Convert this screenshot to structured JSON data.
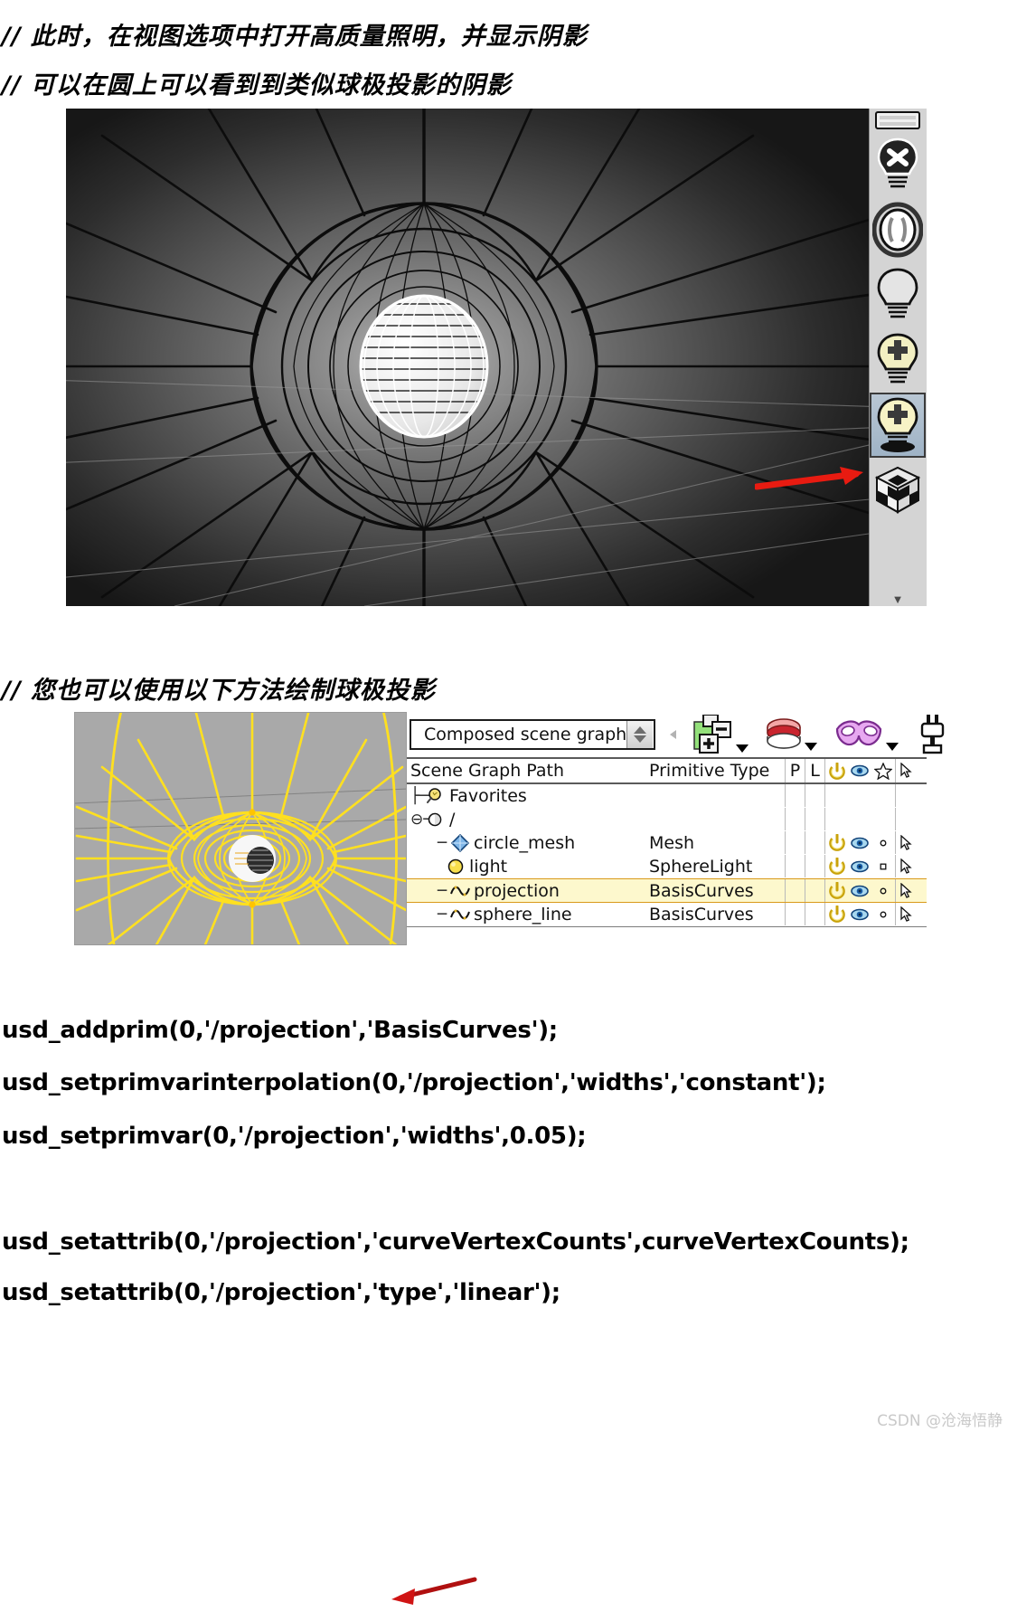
{
  "notes": [
    {
      "slashes": "//",
      "text": "此时，在视图选项中打开高质量照明，并显示阴影"
    },
    {
      "slashes": "//",
      "text": "可以在圆上可以看到到类似球极投影的阴影"
    },
    {
      "slashes": "//",
      "text": "您也可以使用以下方法绘制球极投影"
    }
  ],
  "viewport": {
    "background_color": "#1b1b1b",
    "web_color": "#0a0a0a",
    "sphere_color": "#ffffff",
    "toolbar_background": "#d4d4d4",
    "toolbar_items": [
      {
        "name": "light-off-icon",
        "label": ""
      },
      {
        "name": "ambient-light-icon",
        "label": ""
      },
      {
        "name": "default-light-icon",
        "label": ""
      },
      {
        "name": "add-light-icon",
        "label": ""
      },
      {
        "name": "high-quality-light-icon",
        "label": "",
        "selected": true
      },
      {
        "name": "shadow-cube-icon",
        "label": ""
      }
    ],
    "scroll_down_glyph": "▼"
  },
  "yellow_viewport": {
    "background_color": "#a9a9a9",
    "curve_color": "#ffe01f",
    "sphere_color": "#f7f7f7"
  },
  "scene_graph": {
    "combo_value": "Composed scene graph",
    "toolbar_icons": [
      {
        "name": "add-remove-prim-icon"
      },
      {
        "name": "layer-stack-icon"
      },
      {
        "name": "masking-icon"
      },
      {
        "name": "light-linking-icon"
      }
    ],
    "columns": [
      "Scene Graph Path",
      "Primitive Type",
      "P",
      "L",
      "power-icon",
      "eye-icon",
      "star-icon",
      "pointer-icon"
    ],
    "rows": [
      {
        "indent": 1,
        "tree": "├",
        "icon": "favorites-icon",
        "path": "Favorites",
        "type": "",
        "p": "",
        "l": "",
        "power": false,
        "eye": false,
        "dot": false,
        "cursor": false,
        "selected": false
      },
      {
        "indent": 0,
        "tree": "⊖",
        "icon": "root-prim-icon",
        "path": "/",
        "type": "",
        "p": "",
        "l": "",
        "power": false,
        "eye": false,
        "dot": false,
        "cursor": false,
        "selected": false
      },
      {
        "indent": 2,
        "tree": "─",
        "icon": "mesh-icon",
        "path": "circle_mesh",
        "type": "Mesh",
        "p": "",
        "l": "",
        "power": true,
        "eye": true,
        "dot": true,
        "cursor": true,
        "selected": false
      },
      {
        "indent": 2,
        "tree": "",
        "icon": "light-icon",
        "path": "light",
        "type": "SphereLight",
        "p": "",
        "l": "",
        "power": true,
        "eye": true,
        "dot": true,
        "cursor": true,
        "selected": false
      },
      {
        "indent": 2,
        "tree": "─",
        "icon": "curves-icon",
        "path": "projection",
        "type": "BasisCurves",
        "p": "",
        "l": "",
        "power": true,
        "eye": true,
        "dot": true,
        "cursor": true,
        "selected": true
      },
      {
        "indent": 2,
        "tree": "─",
        "icon": "curves-icon",
        "path": "sphere_line",
        "type": "BasisCurves",
        "p": "",
        "l": "",
        "power": true,
        "eye": true,
        "dot": true,
        "cursor": true,
        "selected": false
      }
    ],
    "selected_row_color": "#fdf8cd",
    "selected_row_border": "#d99a1a"
  },
  "code_lines": [
    "usd_addprim(0,'/projection','BasisCurves');",
    "usd_setprimvarinterpolation(0,'/projection','widths','constant');",
    "usd_setprimvar(0,'/projection','widths',0.05);",
    "usd_setattrib(0,'/projection','curveVertexCounts',curveVertexCounts);",
    "usd_setattrib(0,'/projection','type','linear');"
  ],
  "annotations": {
    "arrow_color": "#e81b11",
    "arrow1_target": "high-quality-light-icon",
    "arrow2_target": "projection-row"
  },
  "watermark": "CSDN @沧海悟静"
}
